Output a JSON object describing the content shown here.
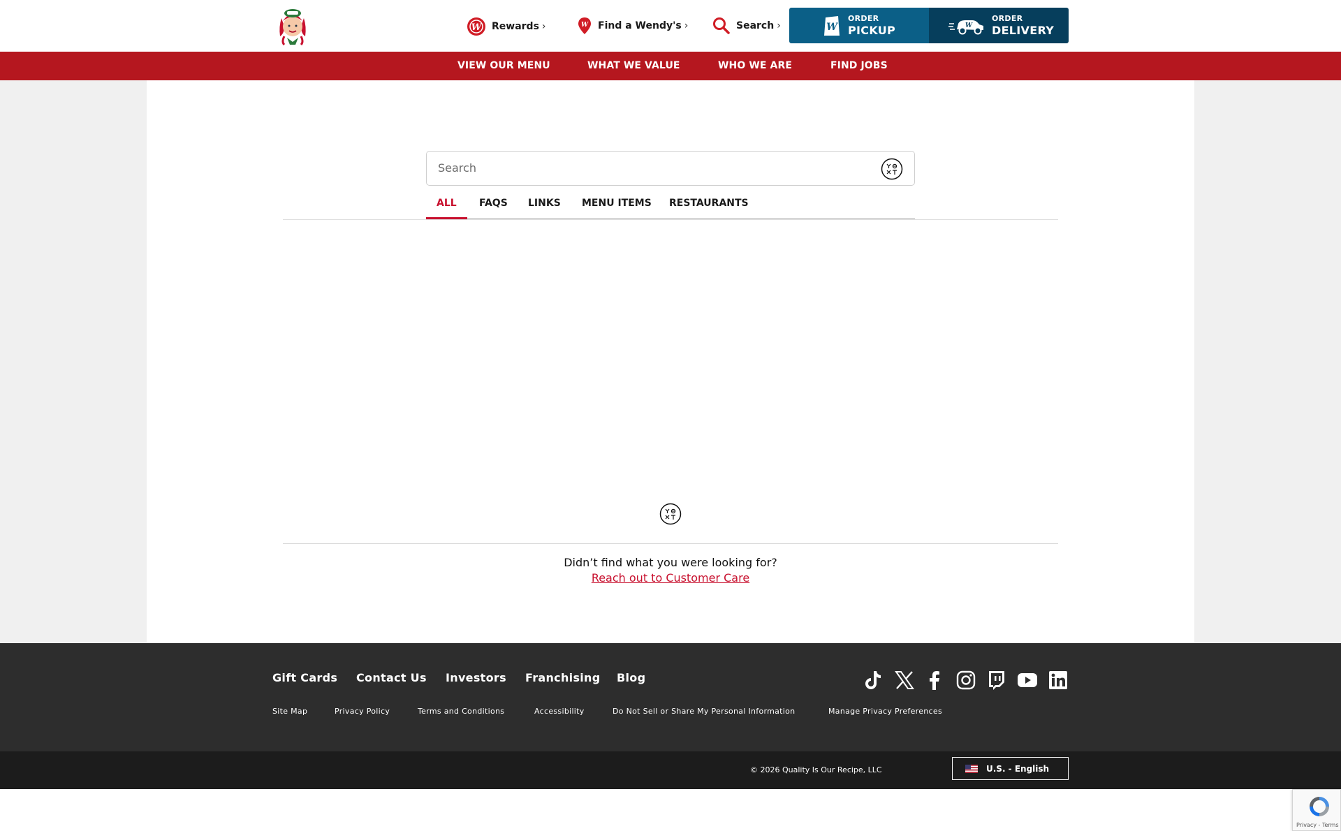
{
  "header": {
    "rewards_label": "Rewards",
    "find_label": "Find a Wendy's",
    "search_label": "Search",
    "chevron": "›",
    "pickup_small": "ORDER",
    "pickup_big": "PICKUP",
    "delivery_small": "ORDER",
    "delivery_big": "DELIVERY"
  },
  "nav": {
    "items": [
      "VIEW OUR MENU",
      "WHAT WE VALUE",
      "WHO WE ARE",
      "FIND JOBS"
    ]
  },
  "search": {
    "placeholder": "Search",
    "tabs": [
      "ALL",
      "FAQS",
      "LINKS",
      "MENU ITEMS",
      "RESTAURANTS"
    ],
    "active_tab": "ALL"
  },
  "no_results": {
    "prompt": "Didn’t find what you were looking for?",
    "link": "Reach out to Customer Care"
  },
  "footer": {
    "main_links": [
      "Gift Cards",
      "Contact Us",
      "Investors",
      "Franchising",
      "Blog"
    ],
    "sub_links": [
      "Site Map",
      "Privacy Policy",
      "Terms and Conditions",
      "Accessibility",
      "Do Not Sell or Share My Personal Information",
      "Manage Privacy Preferences"
    ],
    "social_icons": [
      "tiktok-icon",
      "x-icon",
      "facebook-icon",
      "instagram-icon",
      "twitch-icon",
      "youtube-icon",
      "linkedin-icon"
    ],
    "copyright": "© 2026 Quality Is Our Recipe, LLC",
    "language": "U.S. - English"
  },
  "recaptcha": {
    "text": "Privacy - Terms"
  },
  "colors": {
    "brand_red": "#b5171f",
    "tab_active": "#c8102e",
    "pickup_blue": "#0b5f87",
    "delivery_blue": "#063e5c",
    "footer_bg": "#2d2d2d",
    "bottom_bg": "#1c1c1c"
  }
}
